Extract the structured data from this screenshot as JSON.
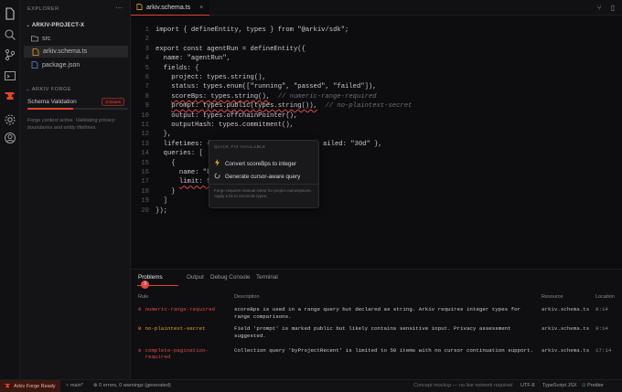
{
  "sidebar": {
    "explorer_label": "EXPLORER",
    "more": "⋯",
    "project": "ARKIV-PROJECT-X",
    "files": [
      {
        "name": "src",
        "icon": "folder-icon"
      },
      {
        "name": "arkiv.schema.ts",
        "icon": "ts-file-icon"
      },
      {
        "name": "package.json",
        "icon": "json-file-icon"
      }
    ],
    "forge_label": "ARKIV FORGE",
    "schema_validation": "Schema Validation",
    "issue_badge": "3 issues",
    "progress": 0.45,
    "forge_desc": "Forge context active. Validating privacy boundaries and entity lifetimes."
  },
  "tab": {
    "name": "arkiv.schema.ts",
    "close": "×"
  },
  "editor": {
    "lines": [
      {
        "n": "1",
        "t": "import { defineEntity, types } from \"@arkiv/sdk\";"
      },
      {
        "n": "2",
        "t": ""
      },
      {
        "n": "3",
        "t": "export const agentRun = defineEntity({"
      },
      {
        "n": "4",
        "t": "  name: \"agentRun\","
      },
      {
        "n": "5",
        "t": "  fields: {"
      },
      {
        "n": "6",
        "t": "    project: types.string(),"
      },
      {
        "n": "7",
        "t": "    status: types.enum([\"running\", \"passed\", \"failed\"]),"
      },
      {
        "n": "8",
        "t": "    scoreBps: types.string(),",
        "c": "  // numeric-range-required",
        "sq": true
      },
      {
        "n": "9",
        "t": "    prompt: types.public(types.string()),",
        "c": "  // no-plaintext-secret",
        "sq": true
      },
      {
        "n": "10",
        "t": "    output: types.offchainPointer(),"
      },
      {
        "n": "11",
        "t": "    outputHash: types.commitment(),"
      },
      {
        "n": "12",
        "t": "  },"
      },
      {
        "n": "13",
        "t": "  lifetimes: {",
        "tail": "ailed: \"30d\" },"
      },
      {
        "n": "14",
        "t": "  queries: ["
      },
      {
        "n": "15",
        "t": "    {"
      },
      {
        "n": "16",
        "t": "      name: \"b"
      },
      {
        "n": "17",
        "t": "      limit: 50",
        "sq": true
      },
      {
        "n": "18",
        "t": "    }"
      },
      {
        "n": "19",
        "t": "  ]"
      },
      {
        "n": "20",
        "t": "});"
      }
    ]
  },
  "quickfix": {
    "title": "QUICK FIX AVAILABLE",
    "items": [
      "Convert scoreBps to integer",
      "Generate cursor-aware query"
    ],
    "footer": "Forge requires manual intent for project namespaces. Apply a fix to reconcile types."
  },
  "panel": {
    "tabs": [
      "Problems",
      "Output",
      "Debug Console",
      "Terminal"
    ],
    "problem_count": "3",
    "headers": [
      "Rule",
      "Description",
      "Resource",
      "Location"
    ],
    "rows": [
      {
        "rule": "numeric-range-required",
        "desc": "scoreBps is used in a range query but declared as string. Arkiv requires integer types for range comparisons.",
        "res": "arkiv.schema.ts",
        "loc": "8:14",
        "sev": "error"
      },
      {
        "rule": "no-plaintext-secret",
        "desc": "Field 'prompt' is marked public but likely contains sensitive input. Privacy assessment suggested.",
        "res": "arkiv.schema.ts",
        "loc": "9:14",
        "sev": "warning"
      },
      {
        "rule": "complete-pagination-required",
        "desc": "Collection query 'byProjectRecent' is limited to 50 items with no cursor continuation support.",
        "res": "arkiv.schema.ts",
        "loc": "17:14",
        "sev": "error"
      }
    ]
  },
  "status": {
    "forge": "Arkiv Forge Ready",
    "branch": "main*",
    "problems": "0 errors, 0 warnings (generated)",
    "mockup": "Concept mockup — no live network required",
    "encoding": "UTF-8",
    "lang": "TypeScript JSX",
    "prettier": "Prettier"
  },
  "colors": {
    "accent": "#e0452a",
    "error": "#e04848",
    "warning": "#e0a020"
  }
}
